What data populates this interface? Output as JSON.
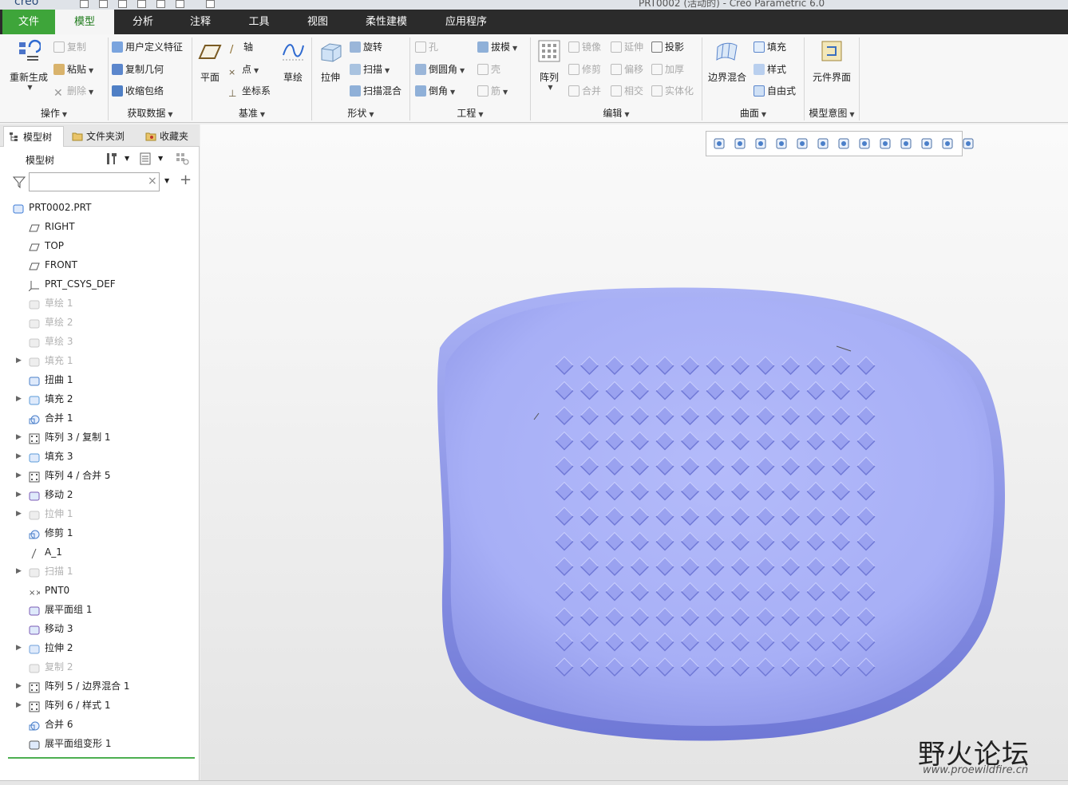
{
  "app": {
    "logo_text": "creo",
    "window_title": "PRT0002 (活动的) - Creo Parametric 6.0"
  },
  "tabs": [
    {
      "label": "文件"
    },
    {
      "label": "模型"
    },
    {
      "label": "分析"
    },
    {
      "label": "注释"
    },
    {
      "label": "工具"
    },
    {
      "label": "视图"
    },
    {
      "label": "柔性建模"
    },
    {
      "label": "应用程序"
    }
  ],
  "ribbon": {
    "operations": {
      "regenerate": "重新生成",
      "copy": "复制",
      "paste": "粘贴",
      "delete": "删除",
      "group": "操作"
    },
    "get_data": {
      "udf": "用户定义特征",
      "copy_geom": "复制几何",
      "shrinkwrap": "收缩包络",
      "group": "获取数据"
    },
    "datum": {
      "plane": "平面",
      "axis": "轴",
      "point": "点",
      "csys": "坐标系",
      "sketch": "草绘",
      "group": "基准"
    },
    "shapes": {
      "extrude": "拉伸",
      "revolve": "旋转",
      "sweep": "扫描",
      "swept_blend": "扫描混合",
      "group": "形状"
    },
    "engineering": {
      "hole": "孔",
      "draft": "拔模",
      "round": "倒圆角",
      "shell": "壳",
      "chamfer": "倒角",
      "rib": "筋",
      "group": "工程"
    },
    "editing": {
      "pattern": "阵列",
      "mirror": "镜像",
      "extend": "延伸",
      "project": "投影",
      "trim": "修剪",
      "offset": "偏移",
      "thicken": "加厚",
      "merge": "合并",
      "intersect": "相交",
      "solidify": "实体化",
      "group": "编辑"
    },
    "surfaces": {
      "boundary_blend": "边界混合",
      "fill": "填充",
      "style": "样式",
      "freestyle": "自由式",
      "group": "曲面"
    },
    "model_intent": {
      "component_interface": "元件界面",
      "group": "模型意图"
    }
  },
  "panel": {
    "tabs": [
      {
        "label": "模型树"
      },
      {
        "label": "文件夹浏"
      },
      {
        "label": "收藏夹"
      }
    ],
    "tree_title": "模型树",
    "search_value": "",
    "clear_glyph": "×",
    "add_glyph": "+"
  },
  "tree": [
    {
      "label": "PRT0002.PRT",
      "icon": "part-icon",
      "expand": false,
      "dim": false,
      "root": true
    },
    {
      "label": "RIGHT",
      "icon": "datum-plane-icon",
      "expand": false,
      "dim": false
    },
    {
      "label": "TOP",
      "icon": "datum-plane-icon",
      "expand": false,
      "dim": false
    },
    {
      "label": "FRONT",
      "icon": "datum-plane-icon",
      "expand": false,
      "dim": false
    },
    {
      "label": "PRT_CSYS_DEF",
      "icon": "csys-icon",
      "expand": false,
      "dim": false
    },
    {
      "label": "草绘 1",
      "icon": "sketch-icon",
      "expand": false,
      "dim": true
    },
    {
      "label": "草绘 2",
      "icon": "sketch-icon",
      "expand": false,
      "dim": true
    },
    {
      "label": "草绘 3",
      "icon": "sketch-icon",
      "expand": false,
      "dim": true
    },
    {
      "label": "填充 1",
      "icon": "fill-icon",
      "expand": true,
      "dim": true
    },
    {
      "label": "扭曲 1",
      "icon": "warp-icon",
      "expand": false,
      "dim": false
    },
    {
      "label": "填充 2",
      "icon": "fill-icon",
      "expand": true,
      "dim": false
    },
    {
      "label": "合并 1",
      "icon": "merge-icon",
      "expand": false,
      "dim": false
    },
    {
      "label": "阵列 3 / 复制 1",
      "icon": "pattern-icon",
      "expand": true,
      "dim": false
    },
    {
      "label": "填充 3",
      "icon": "fill-icon",
      "expand": true,
      "dim": false
    },
    {
      "label": "阵列 4 / 合并 5",
      "icon": "pattern-icon",
      "expand": true,
      "dim": false
    },
    {
      "label": "移动 2",
      "icon": "move-icon",
      "expand": true,
      "dim": false
    },
    {
      "label": "拉伸 1",
      "icon": "extrude-icon",
      "expand": true,
      "dim": true
    },
    {
      "label": "修剪 1",
      "icon": "trim-icon",
      "expand": false,
      "dim": false
    },
    {
      "label": "A_1",
      "icon": "axis-icon",
      "expand": false,
      "dim": false
    },
    {
      "label": "扫描 1",
      "icon": "sweep-icon",
      "expand": true,
      "dim": true
    },
    {
      "label": "PNT0",
      "icon": "point-icon",
      "expand": false,
      "dim": false
    },
    {
      "label": "展平面组 1",
      "icon": "flatten-icon",
      "expand": false,
      "dim": false
    },
    {
      "label": "移动 3",
      "icon": "move-icon",
      "expand": false,
      "dim": false
    },
    {
      "label": "拉伸 2",
      "icon": "extrude-icon",
      "expand": true,
      "dim": false
    },
    {
      "label": "复制 2",
      "icon": "copy-icon",
      "expand": false,
      "dim": true
    },
    {
      "label": "阵列 5 / 边界混合 1",
      "icon": "pattern-icon",
      "expand": true,
      "dim": false
    },
    {
      "label": "阵列 6 / 样式 1",
      "icon": "pattern-icon",
      "expand": true,
      "dim": false
    },
    {
      "label": "合并 6",
      "icon": "merge-icon",
      "expand": false,
      "dim": false
    },
    {
      "label": "展平面组变形 1",
      "icon": "flatten-deform-icon",
      "expand": false,
      "dim": false
    }
  ],
  "view_toolbar": [
    "refit-icon",
    "zoom-in-icon",
    "zoom-out-icon",
    "repaint-icon",
    "display-style-icon",
    "saved-orientations-icon",
    "view-manager-icon",
    "perspective-icon",
    "spin-center-icon",
    "datum-display-icon",
    "annotation-display-icon",
    "appearance-icon",
    "sketch-display-icon"
  ],
  "watermark": {
    "main": "野火论坛",
    "url": "www.proewildfire.cn"
  },
  "colors": {
    "tabbar_bg": "#2b2b2b",
    "file_tab": "#3ea53a",
    "active_tab_text": "#1d7a1a",
    "model_surface": "#a7aff6",
    "model_edge": "#6f78d6"
  }
}
